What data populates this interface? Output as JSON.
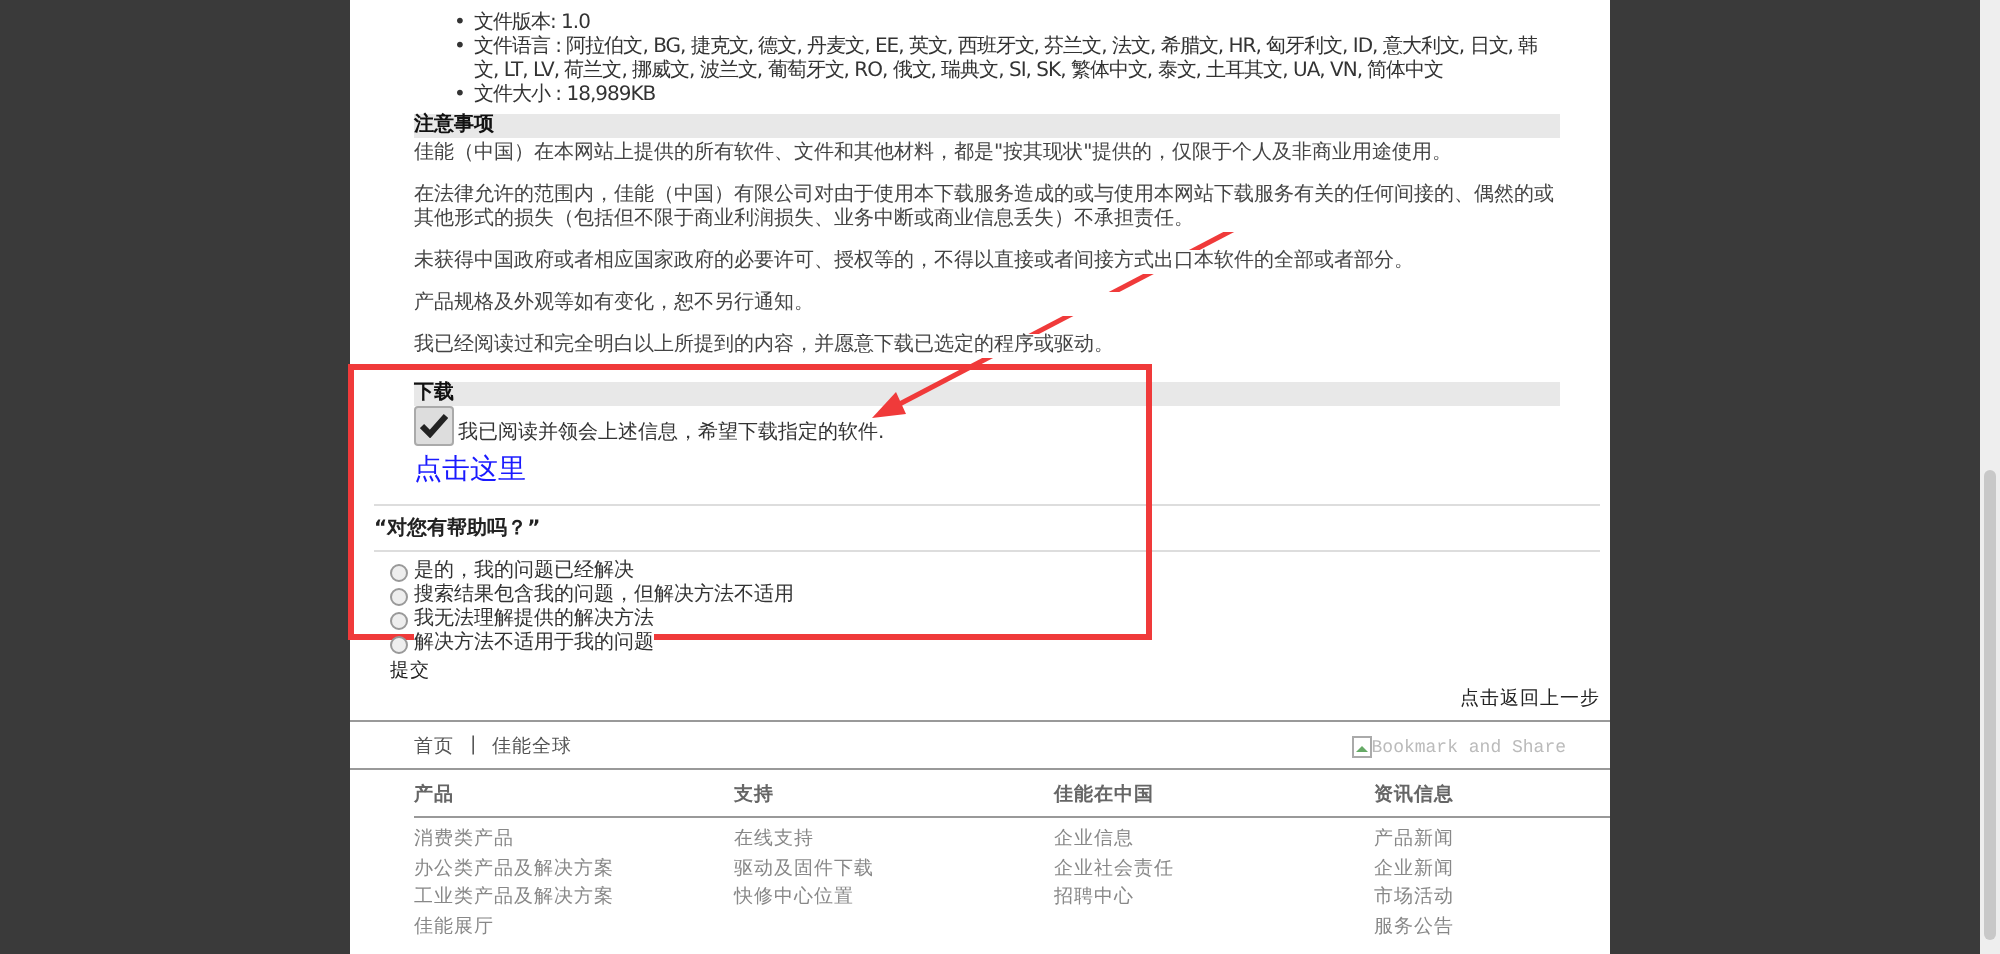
{
  "file_info": [
    {
      "bullet": "•",
      "text": "文件版本: 1.0"
    },
    {
      "bullet": "•",
      "text": "文件语言 : 阿拉伯文, BG, 捷克文, 德文, 丹麦文, EE, 英文, 西班牙文, 芬兰文, 法文, 希腊文, HR, 匈牙利文, ID, 意大利文, 日文, 韩文, LT, LV, 荷兰文, 挪威文, 波兰文, 葡萄牙文, RO, 俄文, 瑞典文, SI, SK, 繁体中文, 泰文, 土耳其文, UA, VN, 简体中文"
    },
    {
      "bullet": "•",
      "text": "文件大小 : 18,989KB"
    }
  ],
  "notice": {
    "heading": "注意事项",
    "paragraphs": [
      "佳能（中国）在本网站上提供的所有软件、文件和其他材料，都是\"按其现状\"提供的，仅限于个人及非商业用途使用。",
      "在法律允许的范围内，佳能（中国）有限公司对由于使用本下载服务造成的或与使用本网站下载服务有关的任何间接的、偶然的或其他形式的损失（包括但不限于商业利润损失、业务中断或商业信息丢失）不承担责任。",
      "未获得中国政府或者相应国家政府的必要许可、授权等的，不得以直接或者间接方式出口本软件的全部或者部分。",
      "产品规格及外观等如有变化，恕不另行通知。",
      "我已经阅读过和完全明白以上所提到的内容，并愿意下载已选定的程序或驱动。"
    ]
  },
  "download": {
    "heading": "下载",
    "agree_label": "我已阅读并领会上述信息，希望下载指定的软件.",
    "agree_checked": true,
    "link": "点击这里"
  },
  "feedback": {
    "question": "“对您有帮助吗？”",
    "options": [
      {
        "label": "是的，我的问题已经解决",
        "selected": false
      },
      {
        "label": "搜索结果包含我的问题，但解决方法不适用",
        "selected": false
      },
      {
        "label": "我无法理解提供的解决方法",
        "selected": false
      },
      {
        "label": "解决方法不适用于我的问题",
        "selected": false
      }
    ],
    "submit": "提交"
  },
  "back_link": "点击返回上一步",
  "footer": {
    "nav": [
      "首页",
      "|",
      "佳能全球"
    ],
    "share_alt": "Bookmark and Share",
    "columns": [
      {
        "heading": "产品",
        "links": [
          "消费类产品",
          "办公类产品及解决方案",
          "工业类产品及解决方案",
          "佳能展厅"
        ]
      },
      {
        "heading": "支持",
        "links": [
          "在线支持",
          "驱动及固件下载",
          "快修中心位置"
        ]
      },
      {
        "heading": "佳能在中国",
        "links": [
          "企业信息",
          "企业社会责任",
          "招聘中心"
        ]
      },
      {
        "heading": "资讯信息",
        "links": [
          "产品新闻",
          "企业新闻",
          "市场活动",
          "服务公告"
        ]
      }
    ]
  }
}
